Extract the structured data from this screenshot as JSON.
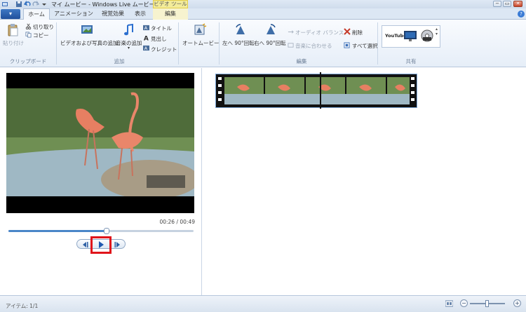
{
  "titlebar": {
    "app_title": "マイ ムービー - Windows Live ムービー ...",
    "context_tab": "ビデオ ツール",
    "minimize": "−",
    "restore": "▭",
    "close": "✕"
  },
  "tabs": {
    "app_menu": "▾",
    "home": "ホーム",
    "animation": "アニメーション",
    "visual_effects": "視覚効果",
    "view": "表示",
    "edit": "編集"
  },
  "ribbon": {
    "clipboard": {
      "paste": "貼り付け",
      "cut": "切り取り",
      "copy": "コピー",
      "group": "クリップボード"
    },
    "add": {
      "add_videos_photos": "ビデオおよび写真の追加",
      "add_music": "音楽の追加",
      "title": "タイトル",
      "caption": "見出し",
      "credits": "クレジット",
      "group": "追加"
    },
    "automovie": "オートムービー",
    "editing": {
      "rotate_left": "左へ 90°回転",
      "rotate_right": "右へ 90°回転",
      "audio_balance": "オーディオ バランス",
      "fit_to_music": "音楽に合わせる",
      "delete": "削除",
      "select_all": "すべて選択",
      "group": "編集"
    },
    "share": {
      "group": "共有",
      "youtube_label": "YouTube"
    }
  },
  "player": {
    "time": "00:26 / 00:49",
    "progress": 0.53
  },
  "status": {
    "items": "アイテム: 1/1"
  },
  "zoom": {
    "minus": "−",
    "plus": "+",
    "level": 0.5
  },
  "colors": {
    "accent": "#2a65b6",
    "highlight": "#e0151b",
    "context_tab": "#f3ec9a"
  }
}
